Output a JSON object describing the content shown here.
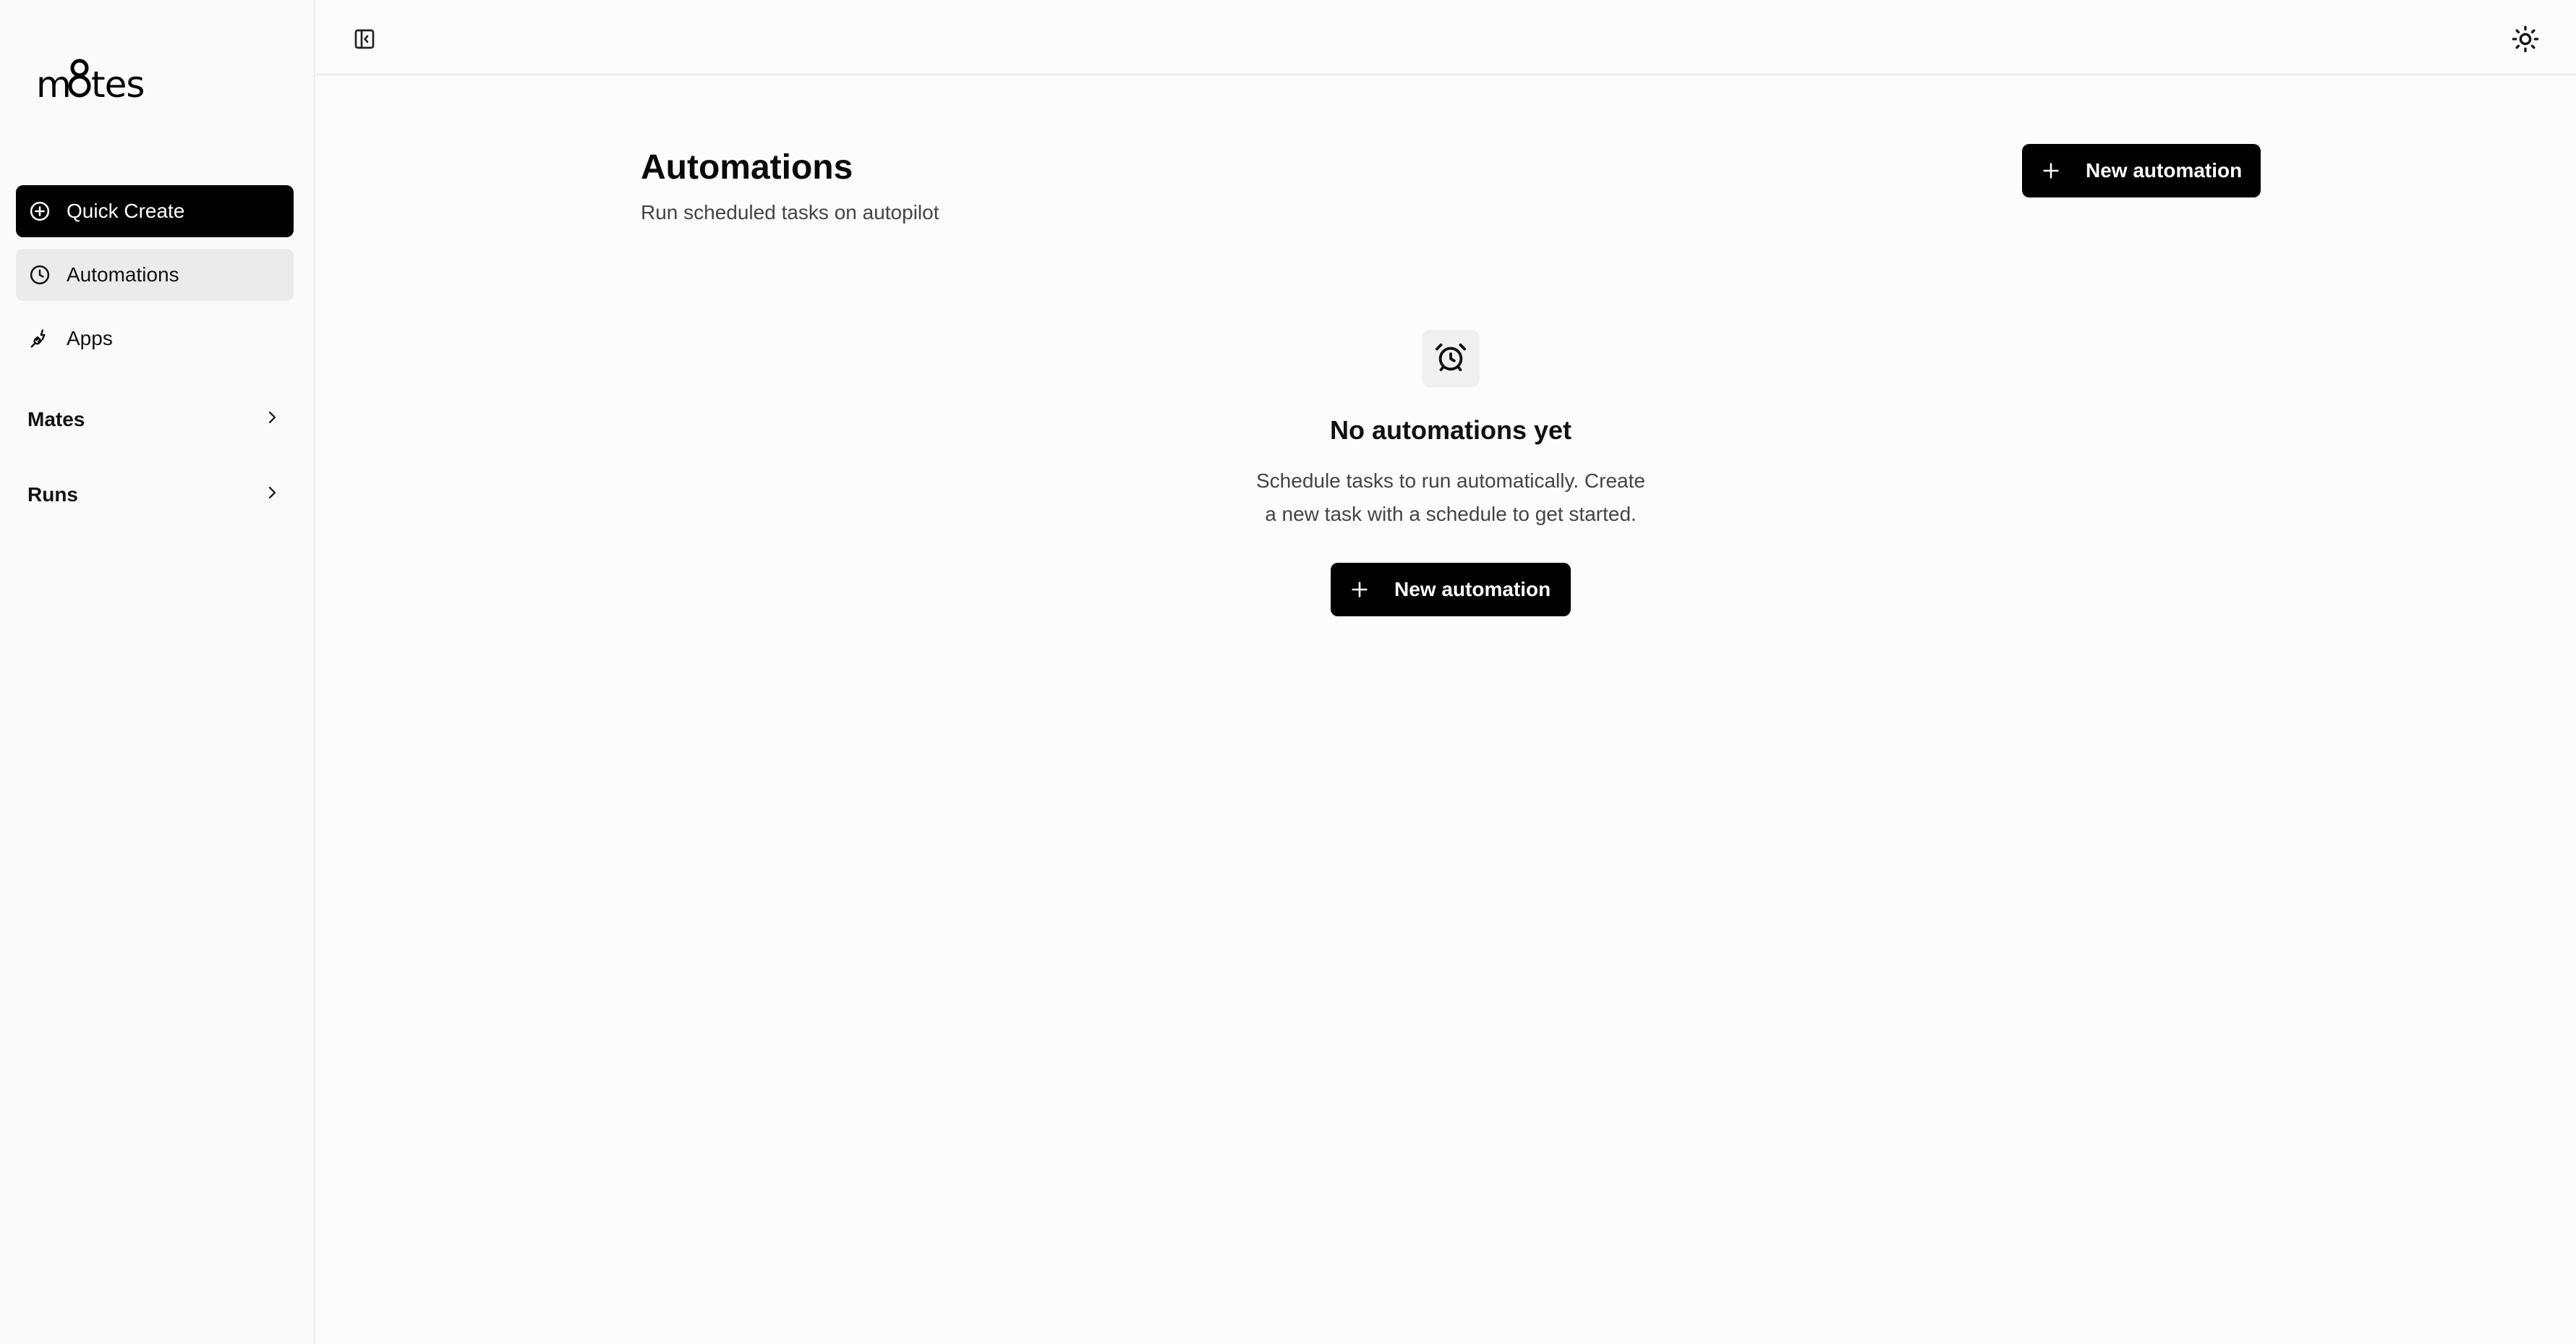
{
  "app": {
    "logo_text": "m8tes"
  },
  "sidebar": {
    "quick_create": {
      "label": "Quick Create",
      "icon": "plus-circle-icon"
    },
    "items": [
      {
        "label": "Automations",
        "icon": "clock-icon",
        "active": true
      },
      {
        "label": "Apps",
        "icon": "plug-icon",
        "active": false
      }
    ],
    "groups": [
      {
        "label": "Mates",
        "icon": "chevron-right-icon"
      },
      {
        "label": "Runs",
        "icon": "chevron-right-icon"
      }
    ]
  },
  "topbar": {
    "toggle_icon": "sidebar-toggle-icon",
    "theme_icon": "sun-icon"
  },
  "main": {
    "title": "Automations",
    "subtitle": "Run scheduled tasks on autopilot",
    "new_button_label": "New automation",
    "empty_state": {
      "icon": "alarm-clock-icon",
      "title": "No automations yet",
      "description_line1": "Schedule tasks to run automatically. Create",
      "description_line2": "a new task with a schedule to get started.",
      "button_label": "New automation"
    }
  },
  "colors": {
    "primary": "#000000",
    "background": "#fcfcfc",
    "active_nav": "#ebebeb"
  }
}
